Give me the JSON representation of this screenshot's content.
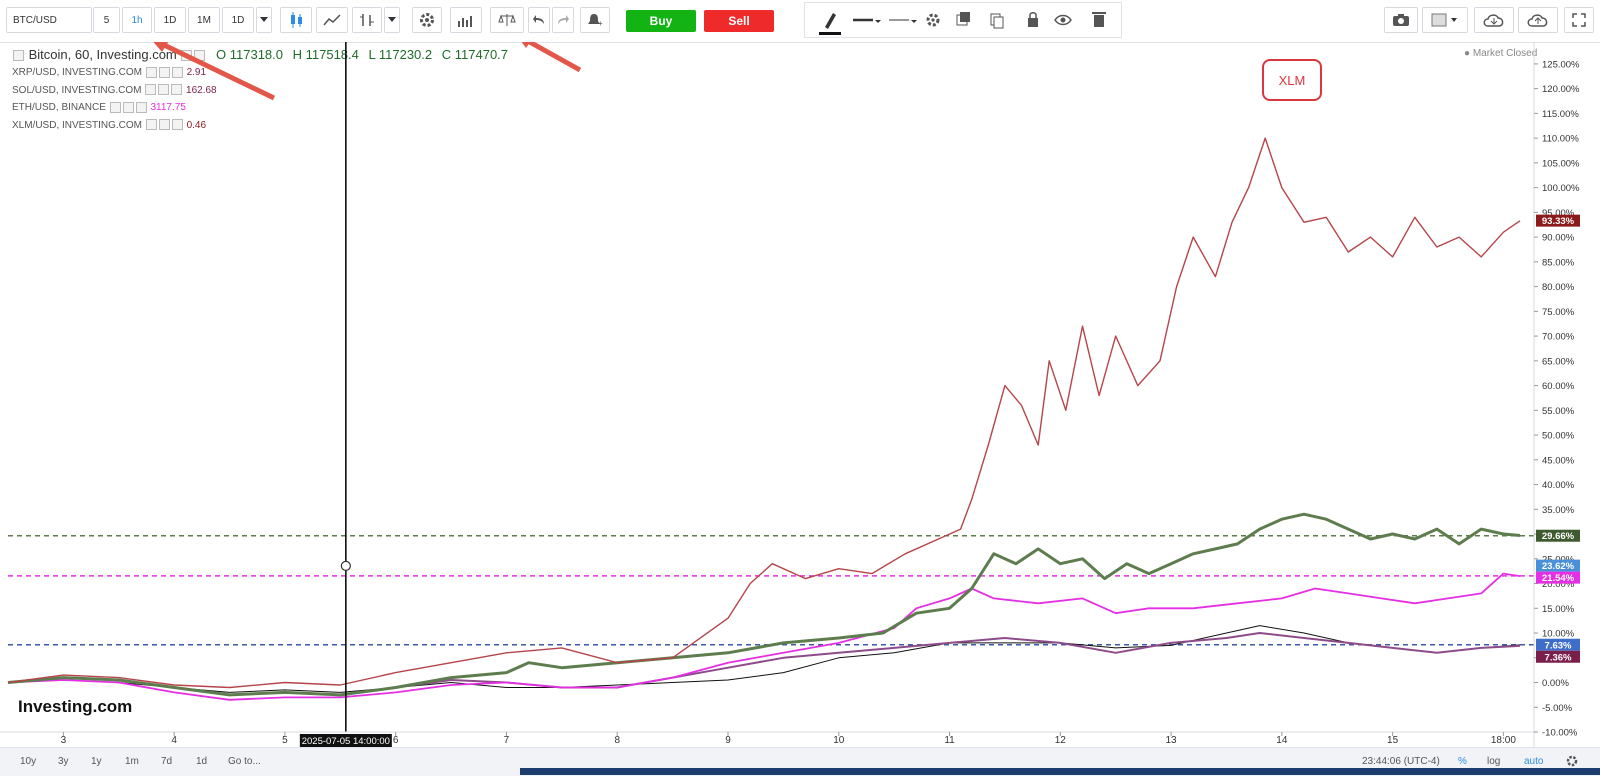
{
  "toolbar": {
    "symbol": "BTC/USD",
    "intervals": [
      "5",
      "1h",
      "1D",
      "1M",
      "1D"
    ],
    "active_interval": "1h",
    "buy_label": "Buy",
    "sell_label": "Sell",
    "icons": [
      "candles-icon",
      "line-chart-icon",
      "bars-icon",
      "dropdown-icon",
      "settings-icon",
      "indicators-icon",
      "compare-icon",
      "undo-icon",
      "redo-icon",
      "alert-icon"
    ],
    "draw_icons": [
      "pen-icon",
      "line-style-icon",
      "line-width-icon",
      "gear-icon",
      "layers-icon",
      "copy-icon",
      "lock-icon",
      "eye-icon",
      "trash-icon"
    ],
    "right_icons": [
      "camera-icon",
      "fill-icon",
      "cloud-download-icon",
      "cloud-upload-icon",
      "fullscreen-icon"
    ]
  },
  "legend": {
    "main": {
      "title": "Bitcoin, 60, Investing.com",
      "open": "O 117318.0",
      "high": "H 117518.4",
      "low": "L 117230.2",
      "close": "C 117470.7"
    },
    "rows": [
      {
        "symbol": "XRP/USD, INVESTING.COM",
        "value": "2.91",
        "color": "#7a1f4a"
      },
      {
        "symbol": "SOL/USD, INVESTING.COM",
        "value": "162.68",
        "color": "#7a1f4a"
      },
      {
        "symbol": "ETH/USD, BINANCE",
        "value": "3117.75",
        "color": "#e42fe4"
      },
      {
        "symbol": "XLM/USD, INVESTING.COM",
        "value": "0.46",
        "color": "#8b1a1a"
      }
    ]
  },
  "market_status": "Market Closed",
  "annotation": "XLM",
  "crosshair_label": "2025-07-05 14:00:00",
  "watermark": "Investing.com",
  "footer": {
    "ranges": [
      "10y",
      "3y",
      "1y",
      "1m",
      "7d",
      "1d",
      "Go to..."
    ],
    "time": "23:44:06 (UTC-4)",
    "percent": "%",
    "log": "log",
    "auto": "auto"
  },
  "chart_data": {
    "type": "line",
    "ylabel": "",
    "y_unit": "%",
    "ylim": [
      -10,
      127
    ],
    "yticks": [
      "125.00%",
      "120.00%",
      "115.00%",
      "110.00%",
      "105.00%",
      "100.00%",
      "95.00%",
      "90.00%",
      "85.00%",
      "80.00%",
      "75.00%",
      "70.00%",
      "65.00%",
      "60.00%",
      "55.00%",
      "50.00%",
      "45.00%",
      "40.00%",
      "35.00%",
      "30.00%",
      "25.00%",
      "20.00%",
      "15.00%",
      "10.00%",
      "5.00%",
      "0.00%",
      "-5.00%",
      "-10.00%"
    ],
    "xticks": [
      "3",
      "4",
      "5",
      "6",
      "7",
      "8",
      "9",
      "10",
      "11",
      "12",
      "13",
      "14",
      "15",
      "18:00"
    ],
    "x_start_day": 2.5,
    "x_end_day": 16.15,
    "series": [
      {
        "name": "XLM",
        "color": "#b5454a",
        "width": 1.4,
        "points": [
          [
            2.5,
            0
          ],
          [
            3.0,
            1.5
          ],
          [
            3.5,
            1
          ],
          [
            4.0,
            -0.5
          ],
          [
            4.5,
            -1
          ],
          [
            5.0,
            0
          ],
          [
            5.5,
            -0.5
          ],
          [
            6.0,
            2
          ],
          [
            6.5,
            4
          ],
          [
            7.0,
            6
          ],
          [
            7.5,
            7
          ],
          [
            8.0,
            4
          ],
          [
            8.5,
            5
          ],
          [
            9.0,
            13
          ],
          [
            9.2,
            20
          ],
          [
            9.4,
            24
          ],
          [
            9.7,
            21
          ],
          [
            10.0,
            23
          ],
          [
            10.3,
            22
          ],
          [
            10.6,
            26
          ],
          [
            10.9,
            29
          ],
          [
            11.1,
            31
          ],
          [
            11.2,
            37
          ],
          [
            11.35,
            48
          ],
          [
            11.5,
            60
          ],
          [
            11.65,
            56
          ],
          [
            11.8,
            48
          ],
          [
            11.9,
            65
          ],
          [
            12.05,
            55
          ],
          [
            12.2,
            72
          ],
          [
            12.35,
            58
          ],
          [
            12.5,
            70
          ],
          [
            12.7,
            60
          ],
          [
            12.9,
            65
          ],
          [
            13.05,
            80
          ],
          [
            13.2,
            90
          ],
          [
            13.4,
            82
          ],
          [
            13.55,
            93
          ],
          [
            13.7,
            100
          ],
          [
            13.85,
            110
          ],
          [
            14.0,
            100
          ],
          [
            14.2,
            93
          ],
          [
            14.4,
            94
          ],
          [
            14.6,
            87
          ],
          [
            14.8,
            90
          ],
          [
            15.0,
            86
          ],
          [
            15.2,
            94
          ],
          [
            15.4,
            88
          ],
          [
            15.6,
            90
          ],
          [
            15.8,
            86
          ],
          [
            16.0,
            91
          ],
          [
            16.15,
            93.3
          ]
        ]
      },
      {
        "name": "SOL",
        "color": "#5e7d4e",
        "width": 3,
        "points": [
          [
            2.5,
            0
          ],
          [
            3.0,
            1
          ],
          [
            3.5,
            0.5
          ],
          [
            4.0,
            -1
          ],
          [
            4.5,
            -2.5
          ],
          [
            5.0,
            -2
          ],
          [
            5.5,
            -2.5
          ],
          [
            6.0,
            -1
          ],
          [
            6.5,
            1
          ],
          [
            7.0,
            2
          ],
          [
            7.2,
            4
          ],
          [
            7.5,
            3
          ],
          [
            8.0,
            4
          ],
          [
            8.5,
            5
          ],
          [
            9.0,
            6
          ],
          [
            9.5,
            8
          ],
          [
            10.0,
            9
          ],
          [
            10.4,
            10
          ],
          [
            10.7,
            14
          ],
          [
            11.0,
            15
          ],
          [
            11.2,
            19
          ],
          [
            11.4,
            26
          ],
          [
            11.6,
            24
          ],
          [
            11.8,
            27
          ],
          [
            12.0,
            24
          ],
          [
            12.2,
            25
          ],
          [
            12.4,
            21
          ],
          [
            12.6,
            24
          ],
          [
            12.8,
            22
          ],
          [
            13.0,
            24
          ],
          [
            13.2,
            26
          ],
          [
            13.4,
            27
          ],
          [
            13.6,
            28
          ],
          [
            13.8,
            31
          ],
          [
            14.0,
            33
          ],
          [
            14.2,
            34
          ],
          [
            14.4,
            33
          ],
          [
            14.6,
            31
          ],
          [
            14.8,
            29
          ],
          [
            15.0,
            30
          ],
          [
            15.2,
            29
          ],
          [
            15.4,
            31
          ],
          [
            15.6,
            28
          ],
          [
            15.8,
            31
          ],
          [
            16.0,
            30
          ],
          [
            16.15,
            29.7
          ]
        ]
      },
      {
        "name": "ETH",
        "color": "#e42fe4",
        "width": 1.8,
        "points": [
          [
            2.5,
            0
          ],
          [
            3.0,
            0.5
          ],
          [
            3.5,
            0
          ],
          [
            4.0,
            -2
          ],
          [
            4.5,
            -3.5
          ],
          [
            5.0,
            -3
          ],
          [
            5.5,
            -3
          ],
          [
            6.0,
            -2
          ],
          [
            6.5,
            -0.5
          ],
          [
            7.0,
            0
          ],
          [
            7.5,
            -1
          ],
          [
            8.0,
            -1
          ],
          [
            8.5,
            1
          ],
          [
            9.0,
            4
          ],
          [
            9.5,
            6
          ],
          [
            10.0,
            8
          ],
          [
            10.5,
            11
          ],
          [
            10.7,
            15
          ],
          [
            11.0,
            17
          ],
          [
            11.2,
            19
          ],
          [
            11.4,
            17
          ],
          [
            11.8,
            16
          ],
          [
            12.2,
            17
          ],
          [
            12.5,
            14
          ],
          [
            12.8,
            15
          ],
          [
            13.2,
            15
          ],
          [
            13.6,
            16
          ],
          [
            14.0,
            17
          ],
          [
            14.3,
            19
          ],
          [
            14.6,
            18
          ],
          [
            14.9,
            17
          ],
          [
            15.2,
            16
          ],
          [
            15.5,
            17
          ],
          [
            15.8,
            18
          ],
          [
            16.0,
            22
          ],
          [
            16.15,
            21.5
          ]
        ]
      },
      {
        "name": "XRP",
        "color": "#8e4b8a",
        "width": 2,
        "points": [
          [
            2.5,
            0
          ],
          [
            3.0,
            1
          ],
          [
            3.5,
            0.5
          ],
          [
            4.0,
            -1
          ],
          [
            4.5,
            -2.5
          ],
          [
            5.0,
            -2
          ],
          [
            5.5,
            -2.5
          ],
          [
            6.0,
            -1
          ],
          [
            6.5,
            0.5
          ],
          [
            7.0,
            0
          ],
          [
            7.5,
            -1
          ],
          [
            8.0,
            -1
          ],
          [
            8.5,
            1
          ],
          [
            9.0,
            3
          ],
          [
            9.5,
            5
          ],
          [
            10.0,
            6
          ],
          [
            10.5,
            7
          ],
          [
            11.0,
            8
          ],
          [
            11.5,
            9
          ],
          [
            12.0,
            8
          ],
          [
            12.5,
            6
          ],
          [
            13.0,
            8
          ],
          [
            13.5,
            9
          ],
          [
            13.8,
            10
          ],
          [
            14.2,
            9
          ],
          [
            14.6,
            8
          ],
          [
            15.0,
            7
          ],
          [
            15.4,
            6
          ],
          [
            15.8,
            7
          ],
          [
            16.15,
            7.4
          ]
        ]
      },
      {
        "name": "BTC",
        "color": "#111111",
        "width": 1,
        "points": [
          [
            2.5,
            0
          ],
          [
            3.0,
            0.5
          ],
          [
            3.5,
            0
          ],
          [
            4.0,
            -1
          ],
          [
            4.5,
            -2
          ],
          [
            5.0,
            -1.5
          ],
          [
            5.5,
            -2
          ],
          [
            6.0,
            -1
          ],
          [
            6.5,
            0
          ],
          [
            7.0,
            -1
          ],
          [
            7.5,
            -1
          ],
          [
            8.0,
            -0.5
          ],
          [
            8.5,
            0
          ],
          [
            9.0,
            0.5
          ],
          [
            9.5,
            2
          ],
          [
            10.0,
            5
          ],
          [
            10.5,
            6
          ],
          [
            11.0,
            8
          ],
          [
            11.5,
            8
          ],
          [
            12.0,
            8
          ],
          [
            12.5,
            7
          ],
          [
            13.0,
            7.5
          ],
          [
            13.5,
            10
          ],
          [
            13.8,
            11.5
          ],
          [
            14.2,
            10
          ],
          [
            14.6,
            8
          ],
          [
            15.0,
            7
          ],
          [
            15.4,
            6
          ],
          [
            15.8,
            7
          ],
          [
            16.15,
            7.6
          ]
        ]
      }
    ],
    "hlines": [
      {
        "y": 29.66,
        "color": "#5e7d4e",
        "style": "dashed"
      },
      {
        "y": 21.54,
        "color": "#e42fe4",
        "style": "dashed"
      },
      {
        "y": 7.63,
        "color": "#3c5aa8",
        "style": "dashed"
      }
    ],
    "price_labels": [
      {
        "value": 93.33,
        "text": "93.33%",
        "color": "#8b1a1a"
      },
      {
        "value": 29.66,
        "text": "29.66%",
        "color": "#3f5a2e"
      },
      {
        "value": 23.62,
        "text": "23.62%",
        "color": "#4a90d9"
      },
      {
        "value": 21.54,
        "text": "21.54%",
        "color": "#e42fe4"
      },
      {
        "value": 7.63,
        "text": "7.63%",
        "color": "#3f6ec8"
      },
      {
        "value": 7.36,
        "text": "7.36%",
        "color": "#7a1f4a"
      }
    ],
    "crosshair_day": 5.55,
    "grid": false,
    "legend_position": "top-left"
  }
}
